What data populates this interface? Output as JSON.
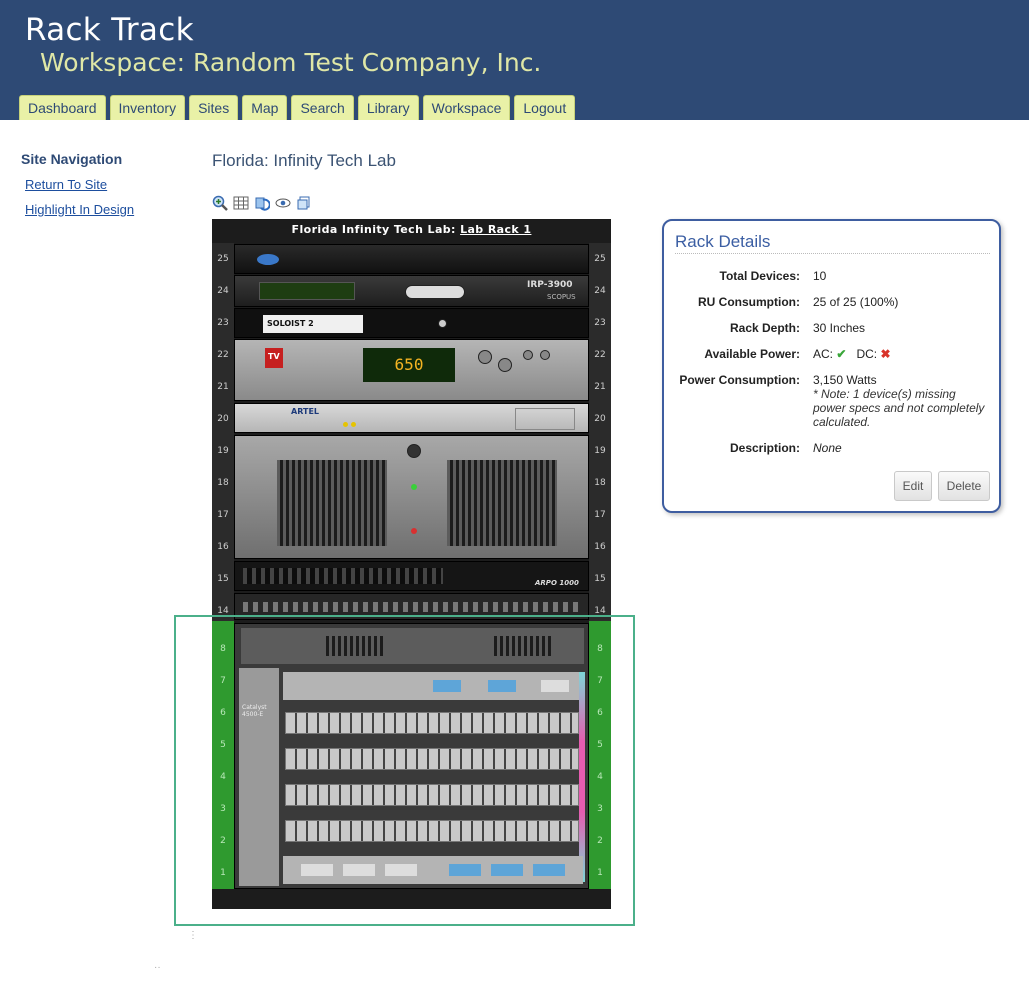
{
  "header": {
    "app_title": "Rack Track",
    "workspace_title": "Workspace: Random Test Company, Inc.",
    "nav": [
      "Dashboard",
      "Inventory",
      "Sites",
      "Map",
      "Search",
      "Library",
      "Workspace",
      "Logout"
    ]
  },
  "sidebar": {
    "title": "Site Navigation",
    "links": [
      "Return To Site",
      "Highlight In Design"
    ]
  },
  "main": {
    "page_title": "Florida: Infinity Tech Lab",
    "toolbar_icons": [
      "zoom-in-icon",
      "grid-icon",
      "refresh-icon",
      "eye-icon",
      "copy-icon"
    ]
  },
  "rack": {
    "title_prefix": "Florida Infinity Tech Lab:",
    "title_link": "Lab Rack 1",
    "units": [
      "25",
      "24",
      "23",
      "22",
      "21",
      "20",
      "19",
      "18",
      "17",
      "16",
      "15",
      "14",
      "8",
      "7",
      "6",
      "5",
      "4",
      "3",
      "2",
      "1"
    ],
    "devices": {
      "irp_label": "IRP-3900",
      "scopus_label": "SCOPUS",
      "soloist_label": "SOLOIST 2",
      "tv_lcd": "650",
      "tv_badge": "TV",
      "artel_label": "ARTEL",
      "arpo_label": "ARPO 1000",
      "catalyst_label": "Catalyst 4500-E"
    },
    "highlight_color": "#4bb08a",
    "rail_green": "#2f9a2f"
  },
  "details": {
    "title": "Rack Details",
    "rows": [
      {
        "label": "Total Devices:",
        "value": "10"
      },
      {
        "label": "RU Consumption:",
        "value": "25 of 25 (100%)"
      },
      {
        "label": "Rack Depth:",
        "value": "30 Inches"
      },
      {
        "label": "Available Power:",
        "ac": "AC:",
        "dc": "DC:"
      },
      {
        "label": "Power Consumption:",
        "value": "3,150 Watts",
        "note": "* Note: 1 device(s) missing power specs and not completely calculated."
      },
      {
        "label": "Description:",
        "value": "None"
      }
    ],
    "buttons": {
      "edit": "Edit",
      "delete": "Delete"
    },
    "ac_status": "available",
    "dc_status": "unavailable"
  },
  "colors": {
    "header_bg": "#2e4a75",
    "nav_tab_bg": "#e9f1a7",
    "workspace_text": "#dfe7a6",
    "panel_border": "#3e5da0"
  }
}
